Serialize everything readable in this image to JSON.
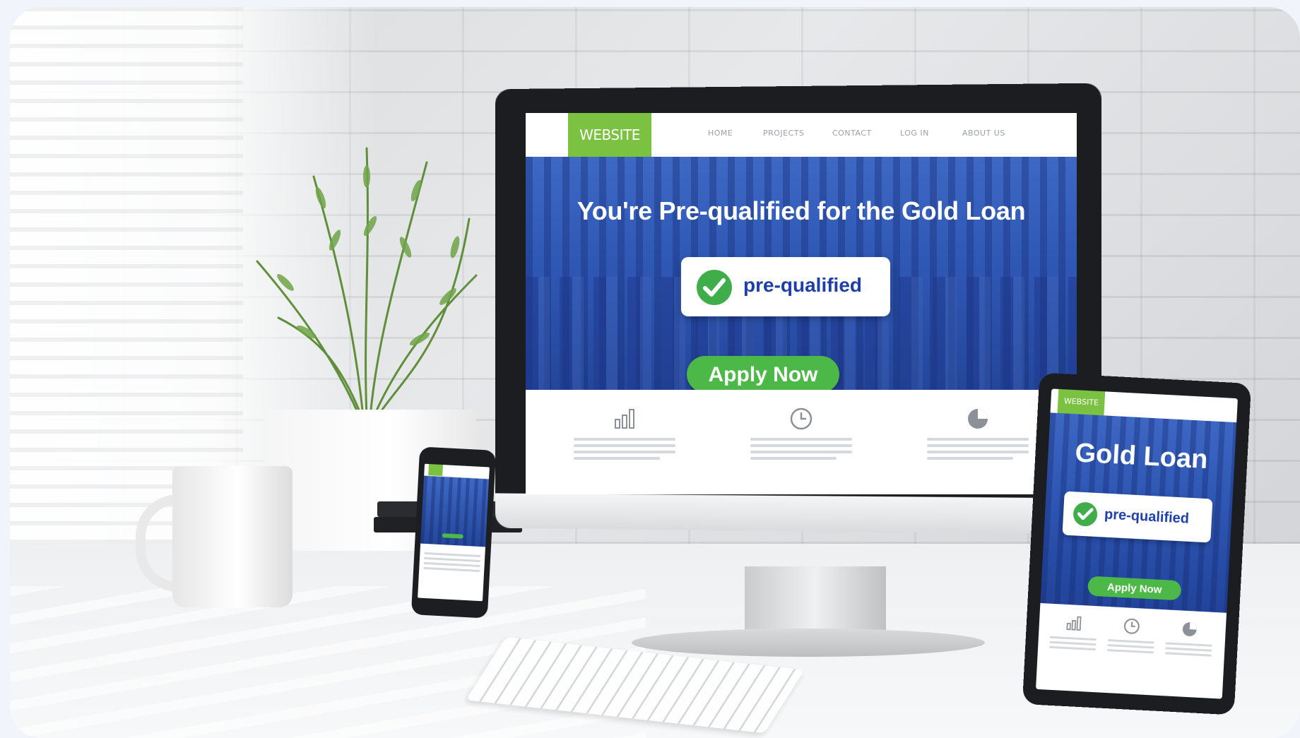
{
  "desktop": {
    "nav": {
      "brand": "WEBSITE",
      "items": [
        "HOME",
        "PROJECTS",
        "CONTACT",
        "LOG IN",
        "ABOUT US"
      ]
    },
    "hero": {
      "title": "You're Pre-qualified for the Gold Loan",
      "badge_text": "pre-qualified",
      "cta_label": "Apply Now"
    },
    "features": [
      {
        "icon": "bar-chart-icon"
      },
      {
        "icon": "clock-icon"
      },
      {
        "icon": "pie-chart-icon"
      }
    ]
  },
  "tablet": {
    "nav": {
      "brand": "WEBSITE"
    },
    "hero": {
      "title": "Gold Loan",
      "badge_text": "pre-qualified",
      "cta_label": "Apply Now"
    }
  },
  "colors": {
    "brand_green": "#7cc242",
    "cta_green": "#4cb847",
    "hero_blue": "#2f58b5",
    "badge_text_blue": "#1f3fa8",
    "check_green": "#3fae4a"
  }
}
